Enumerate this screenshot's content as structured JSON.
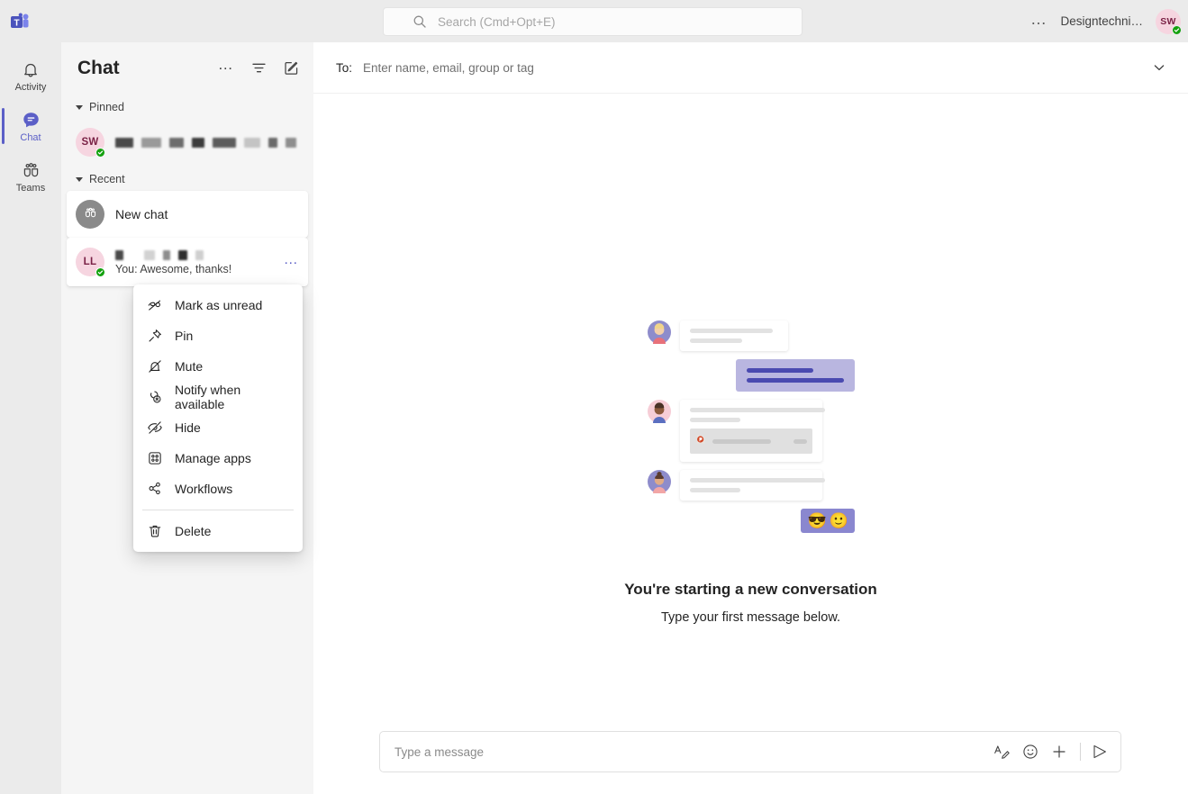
{
  "topbar": {
    "logo_icon": "teams-logo-icon",
    "search": {
      "icon": "search-icon",
      "placeholder": "Search (Cmd+Opt+E)",
      "value": ""
    },
    "more_options": "…",
    "org_name": "Designtechni…",
    "avatar": {
      "initials": "SW",
      "presence": "available",
      "presence_icon": "check-icon"
    }
  },
  "rail": {
    "items": [
      {
        "label": "Activity",
        "icon": "bell-icon",
        "active": false
      },
      {
        "label": "Chat",
        "icon": "chat-bubble-icon",
        "active": true
      },
      {
        "label": "Teams",
        "icon": "teams-people-icon",
        "active": false
      }
    ]
  },
  "chat_list": {
    "title": "Chat",
    "actions": [
      {
        "name": "more-options",
        "icon": "ellipsis-icon",
        "label": "…"
      },
      {
        "name": "filter",
        "icon": "filter-icon",
        "label": ""
      },
      {
        "name": "new-chat",
        "icon": "compose-icon",
        "label": ""
      }
    ],
    "groups": [
      {
        "label": "Pinned",
        "expanded": true,
        "rows": [
          {
            "avatar": {
              "initials": "SW",
              "style": "pink",
              "presence": "available"
            },
            "name": "",
            "name_redacted": true,
            "subtitle": "",
            "selected": false
          }
        ]
      },
      {
        "label": "Recent",
        "expanded": true,
        "rows": [
          {
            "avatar": {
              "initials": "",
              "style": "gray",
              "icon": "group-people-icon",
              "presence": "none"
            },
            "name": "New chat",
            "name_redacted": false,
            "subtitle": "",
            "selected": true
          },
          {
            "avatar": {
              "initials": "LL",
              "style": "pink",
              "presence": "available"
            },
            "name": "",
            "name_redacted": true,
            "subtitle": "You: Awesome, thanks!",
            "selected": true,
            "more_icon": "ellipsis-icon"
          }
        ]
      }
    ]
  },
  "context_menu": {
    "open": true,
    "items": [
      {
        "label": "Mark as unread",
        "icon": "mark-unread-icon"
      },
      {
        "label": "Pin",
        "icon": "pin-icon"
      },
      {
        "label": "Mute",
        "icon": "bell-off-icon"
      },
      {
        "label": "Notify when available",
        "icon": "notify-available-icon"
      },
      {
        "label": "Hide",
        "icon": "eye-off-icon"
      },
      {
        "label": "Manage apps",
        "icon": "apps-grid-icon"
      },
      {
        "label": "Workflows",
        "icon": "workflows-icon"
      }
    ],
    "danger_item": {
      "label": "Delete",
      "icon": "trash-icon"
    }
  },
  "main": {
    "to_field": {
      "label": "To:",
      "placeholder": "Enter name, email, group or tag",
      "value": "",
      "chevron_icon": "chevron-down-icon"
    },
    "empty_state": {
      "title": "You're starting a new conversation",
      "subtitle": "Type your first message below.",
      "illustration": {
        "file_chip_icon": "powerpoint-file-icon",
        "emoji": [
          "😎",
          "🙂"
        ]
      }
    },
    "composer": {
      "placeholder": "Type a message",
      "value": "",
      "actions": [
        {
          "name": "format",
          "icon": "format-text-icon"
        },
        {
          "name": "emoji",
          "icon": "emoji-icon"
        },
        {
          "name": "add-attachment",
          "icon": "plus-icon"
        },
        {
          "name": "send",
          "icon": "send-icon"
        }
      ]
    }
  },
  "colors": {
    "accent": "#5b5fc7",
    "presence_available": "#13a10e",
    "panel_bg": "#f5f5f5",
    "rail_bg": "#ebebeb",
    "avatar_pink": "#f6d5e0",
    "avatar_pink_text": "#7a2246"
  }
}
